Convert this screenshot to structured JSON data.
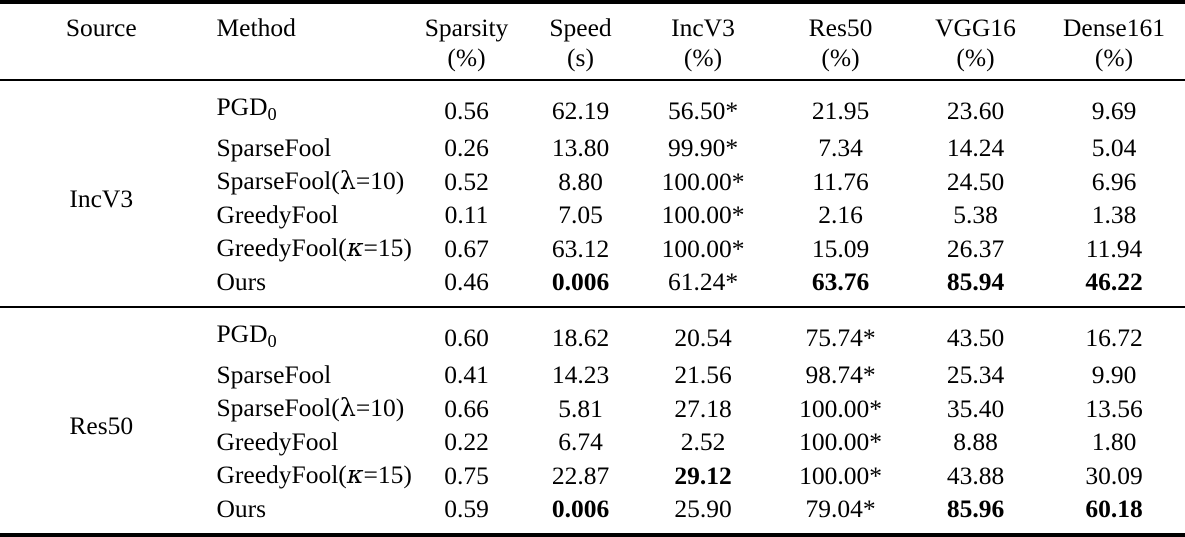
{
  "table": {
    "columns": [
      {
        "key": "source",
        "label": "Source",
        "unit": ""
      },
      {
        "key": "method",
        "label": "Method",
        "unit": ""
      },
      {
        "key": "sparsity",
        "label": "Sparsity",
        "unit": "(%)"
      },
      {
        "key": "speed",
        "label": "Speed",
        "unit": "(s)"
      },
      {
        "key": "incv3",
        "label": "IncV3",
        "unit": "(%)"
      },
      {
        "key": "res50",
        "label": "Res50",
        "unit": "(%)"
      },
      {
        "key": "vgg16",
        "label": "VGG16",
        "unit": "(%)"
      },
      {
        "key": "dense161",
        "label": "Dense161",
        "unit": "(%)"
      }
    ],
    "blocks": [
      {
        "source": "IncV3",
        "rows": [
          {
            "method_prefix": "PGD",
            "method_sub": "0",
            "method_suffix": "",
            "sparsity": "0.56",
            "speed": "62.19",
            "incv3": "56.50*",
            "res50": "21.95",
            "vgg16": "23.60",
            "dense161": "9.69",
            "bold": []
          },
          {
            "method_prefix": "SparseFool",
            "method_sub": "",
            "method_suffix": "",
            "sparsity": "0.26",
            "speed": "13.80",
            "incv3": "99.90*",
            "res50": "7.34",
            "vgg16": "14.24",
            "dense161": "5.04",
            "bold": []
          },
          {
            "method_prefix": "SparseFool(",
            "method_greek": "λ",
            "method_greek_style": "lambda",
            "method_sub": "",
            "method_suffix": "=10)",
            "sparsity": "0.52",
            "speed": "8.80",
            "incv3": "100.00*",
            "res50": "11.76",
            "vgg16": "24.50",
            "dense161": "6.96",
            "bold": []
          },
          {
            "method_prefix": "GreedyFool",
            "method_sub": "",
            "method_suffix": "",
            "sparsity": "0.11",
            "speed": "7.05",
            "incv3": "100.00*",
            "res50": "2.16",
            "vgg16": "5.38",
            "dense161": "1.38",
            "bold": []
          },
          {
            "method_prefix": "GreedyFool(",
            "method_greek": "κ",
            "method_greek_style": "kappa",
            "method_sub": "",
            "method_suffix": "=15)",
            "sparsity": "0.67",
            "speed": "63.12",
            "incv3": "100.00*",
            "res50": "15.09",
            "vgg16": "26.37",
            "dense161": "11.94",
            "bold": []
          },
          {
            "method_prefix": "Ours",
            "method_sub": "",
            "method_suffix": "",
            "sparsity": "0.46",
            "speed": "0.006",
            "incv3": "61.24*",
            "res50": "63.76",
            "vgg16": "85.94",
            "dense161": "46.22",
            "bold": [
              "speed",
              "res50",
              "vgg16",
              "dense161"
            ]
          }
        ]
      },
      {
        "source": "Res50",
        "rows": [
          {
            "method_prefix": "PGD",
            "method_sub": "0",
            "method_suffix": "",
            "sparsity": "0.60",
            "speed": "18.62",
            "incv3": "20.54",
            "res50": "75.74*",
            "vgg16": "43.50",
            "dense161": "16.72",
            "bold": []
          },
          {
            "method_prefix": "SparseFool",
            "method_sub": "",
            "method_suffix": "",
            "sparsity": "0.41",
            "speed": "14.23",
            "incv3": "21.56",
            "res50": "98.74*",
            "vgg16": "25.34",
            "dense161": "9.90",
            "bold": []
          },
          {
            "method_prefix": "SparseFool(",
            "method_greek": "λ",
            "method_greek_style": "lambda",
            "method_sub": "",
            "method_suffix": "=10)",
            "sparsity": "0.66",
            "speed": "5.81",
            "incv3": "27.18",
            "res50": "100.00*",
            "vgg16": "35.40",
            "dense161": "13.56",
            "bold": []
          },
          {
            "method_prefix": "GreedyFool",
            "method_sub": "",
            "method_suffix": "",
            "sparsity": "0.22",
            "speed": "6.74",
            "incv3": "2.52",
            "res50": "100.00*",
            "vgg16": "8.88",
            "dense161": "1.80",
            "bold": []
          },
          {
            "method_prefix": "GreedyFool(",
            "method_greek": "κ",
            "method_greek_style": "kappa",
            "method_sub": "",
            "method_suffix": "=15)",
            "sparsity": "0.75",
            "speed": "22.87",
            "incv3": "29.12",
            "res50": "100.00*",
            "vgg16": "43.88",
            "dense161": "30.09",
            "bold": [
              "incv3"
            ]
          },
          {
            "method_prefix": "Ours",
            "method_sub": "",
            "method_suffix": "",
            "sparsity": "0.59",
            "speed": "0.006",
            "incv3": "25.90",
            "res50": "79.04*",
            "vgg16": "85.96",
            "dense161": "60.18",
            "bold": [
              "speed",
              "vgg16",
              "dense161"
            ]
          }
        ]
      }
    ]
  }
}
